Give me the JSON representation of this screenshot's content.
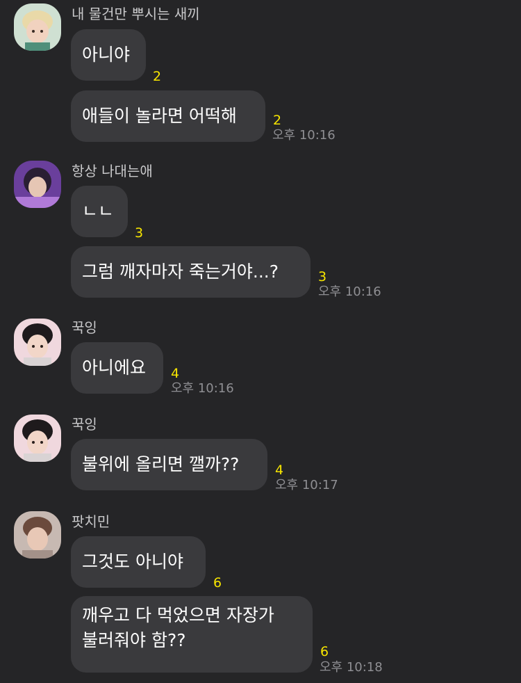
{
  "messages": [
    {
      "sender": "내 물건만 뿌시는 새끼",
      "avatar_icon": "profile-photo-icon",
      "lines": [
        {
          "text": "아니야",
          "unread": "2"
        },
        {
          "text": "애들이 놀라면 어떡해",
          "unread": "2",
          "time": "오후 10:16"
        }
      ]
    },
    {
      "sender": "항상 나대는애",
      "avatar_icon": "profile-photo-icon",
      "lines": [
        {
          "text": "ㄴㄴ",
          "unread": "3"
        },
        {
          "text": "그럼 깨자마자 죽는거야...?",
          "unread": "3",
          "time": "오후 10:16"
        }
      ]
    },
    {
      "sender": "꾹잉",
      "avatar_icon": "profile-photo-icon",
      "lines": [
        {
          "text": "아니에요",
          "unread": "4",
          "time": "오후 10:16"
        }
      ]
    },
    {
      "sender": "꾹잉",
      "avatar_icon": "profile-photo-icon",
      "lines": [
        {
          "text": "불위에 올리면 깰까??",
          "unread": "4",
          "time": "오후 10:17"
        }
      ]
    },
    {
      "sender": "팟치민",
      "avatar_icon": "profile-photo-icon",
      "lines": [
        {
          "text": "그것도 아니야",
          "unread": "6"
        },
        {
          "text": "깨우고 다 먹었으면 자장가\n불러줘야 함??",
          "unread": "6",
          "time": "오후 10:18"
        }
      ]
    }
  ],
  "colors": {
    "background": "#252527",
    "bubble": "#3a3a3d",
    "unread": "#f7e500",
    "time": "#8f8f93",
    "sender": "#c9c9cb"
  }
}
